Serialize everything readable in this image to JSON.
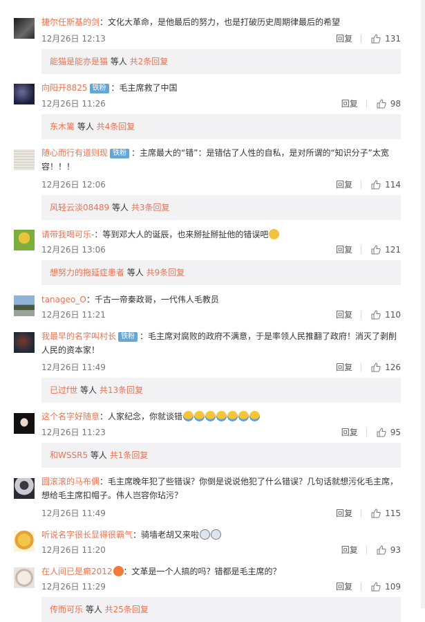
{
  "ui": {
    "reply_label": "回复",
    "people_suffix": " 等人 "
  },
  "comments": [
    {
      "user": "捷尔任斯基的剑",
      "badge": "",
      "text": "：文化大革命，是他最后的努力，也是打破历史周期律最后的希望",
      "time": "12月26日 12:13",
      "likes": "131",
      "sub": {
        "user": "能猫是能亦是猫",
        "count": "共2条回复"
      }
    },
    {
      "user": "向阳开8825",
      "badge": "铁粉",
      "text": "：毛主席救了中国",
      "time": "12月26日 11:26",
      "likes": "98",
      "sub": {
        "user": "东木篱",
        "count": "共4条回复"
      }
    },
    {
      "user": "随心而行有道则现",
      "badge": "铁粉",
      "text": "：主席最大的“错”：是错估了人性的自私，是对所谓的“知识分子”太宽容！！！",
      "time": "12月26日 12:06",
      "likes": "114",
      "sub": {
        "user": "风轻云淡08489",
        "count": "共3条回复"
      }
    },
    {
      "user": "请带我喝可乐-",
      "badge": "",
      "text": "：等到邓大人的诞辰，也来掰扯掰扯他的错误吧",
      "time": "12月26日 13:06",
      "likes": "121",
      "sub": {
        "user": "想努力的拖延症患者",
        "count": "共9条回复"
      }
    },
    {
      "user": "tanageo_O",
      "badge": "",
      "text": "：千古一帝秦政哥，一代伟人毛教员",
      "time": "12月26日 11:21",
      "likes": "110",
      "sub": null
    },
    {
      "user": "我最早的名字叫村长",
      "badge": "铁粉",
      "text": "：毛主席对腐败的政府不满意，于是率领人民推翻了政府！消灭了剥削人民的资本家！",
      "time": "12月26日 11:49",
      "likes": "126",
      "sub": {
        "user": "已过f世",
        "count": "共13条回复"
      }
    },
    {
      "user": "这个名字好随意",
      "badge": "",
      "text": "：人家纪念，你就谈错",
      "time": "12月26日 11:23",
      "likes": "95",
      "sub": {
        "user": "和WSSR5",
        "count": "共1条回复"
      }
    },
    {
      "user": "圆滚滚的马布偶",
      "badge": "",
      "text": "：毛主席晚年犯了些错误？你倒是说说他犯了什么错误？几句话就想污化毛主席，想给毛主席扣帽子。伟人岂容你玷污？",
      "time": "12月26日 11:49",
      "likes": "115",
      "sub": null
    },
    {
      "user": "听说名字很长显得很霸气",
      "badge": "",
      "text": "：骑墙老胡又来啦",
      "time": "12月26日 11:20",
      "likes": "93",
      "sub": null
    },
    {
      "user": "在人间已是癫2012",
      "badge": "",
      "text": "：文革是一个人搞的吗？错都是毛主席的？",
      "time": "12月26日 11:29",
      "likes": "109",
      "sub": {
        "user": "传而可乐",
        "count": "共25条回复"
      }
    }
  ]
}
